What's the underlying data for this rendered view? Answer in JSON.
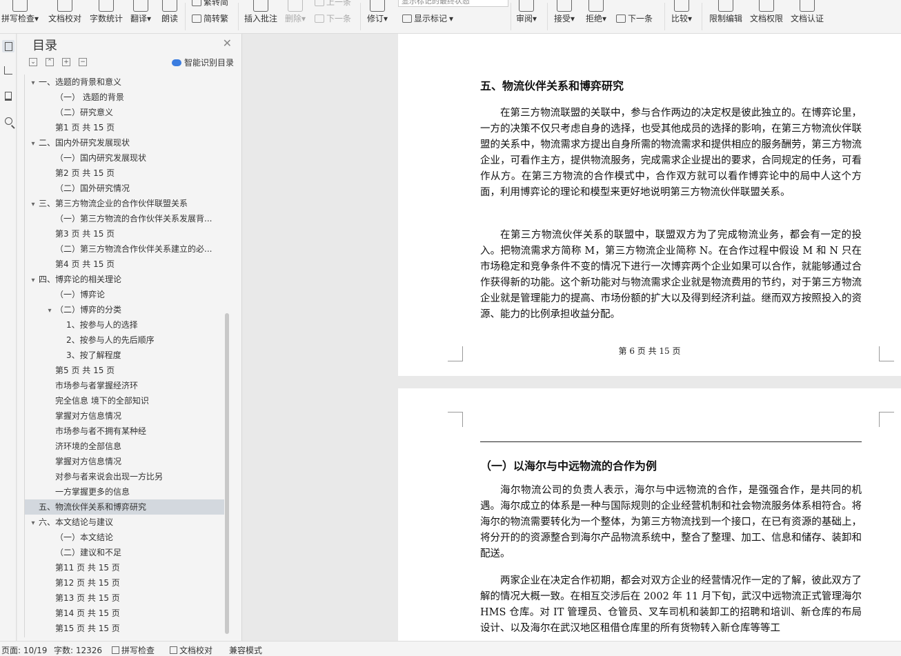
{
  "ribbon": {
    "buttons": [
      {
        "label": "拼写检查",
        "dropdown": true
      },
      {
        "label": "文档校对",
        "dropdown": false
      },
      {
        "label": "字数统计",
        "dropdown": false
      },
      {
        "label": "翻译",
        "dropdown": true
      },
      {
        "label": "朗读",
        "dropdown": false
      },
      {
        "label": "插入批注",
        "dropdown": false
      },
      {
        "label": "删除",
        "dropdown": true,
        "disabled": true
      },
      {
        "label": "修订",
        "dropdown": true
      },
      {
        "label": "审阅",
        "dropdown": true
      },
      {
        "label": "接受",
        "dropdown": true
      },
      {
        "label": "拒绝",
        "dropdown": true
      },
      {
        "label": "比较",
        "dropdown": true
      },
      {
        "label": "限制编辑",
        "dropdown": false
      },
      {
        "label": "文档权限",
        "dropdown": false
      },
      {
        "label": "文档认证",
        "dropdown": false
      }
    ],
    "simp_trad_top": "繁转简",
    "trad_simp": "简转繁",
    "prev": "上一条",
    "next": "下一条",
    "show_markup": "显示标记",
    "markup_mode": "显示标记的最终状态",
    "next_change": "下一条"
  },
  "toc": {
    "title": "目录",
    "smart_label": "智能识别目录",
    "items": [
      {
        "text": "一、选题的背景和意义",
        "level": 0,
        "toggle": "▾"
      },
      {
        "text": "（一）  选题的背景",
        "level": 1,
        "toggle": ""
      },
      {
        "text": "（二）研究意义",
        "level": 1,
        "toggle": ""
      },
      {
        "text": "第1 页 共 15 页",
        "level": 1,
        "toggle": ""
      },
      {
        "text": "二、国内外研究发展现状",
        "level": 0,
        "toggle": "▾"
      },
      {
        "text": "（一）国内研究发展现状",
        "level": 1,
        "toggle": ""
      },
      {
        "text": "第2 页 共 15 页",
        "level": 1,
        "toggle": ""
      },
      {
        "text": "（二）国外研究情况",
        "level": 1,
        "toggle": ""
      },
      {
        "text": "三、第三方物流企业的合作伙伴联盟关系",
        "level": 0,
        "toggle": "▾"
      },
      {
        "text": "（一）第三方物流的合作伙伴关系发展背...",
        "level": 1,
        "toggle": ""
      },
      {
        "text": "第3 页 共 15 页",
        "level": 1,
        "toggle": ""
      },
      {
        "text": "（二）第三方物流合作伙伴关系建立的必...",
        "level": 1,
        "toggle": ""
      },
      {
        "text": "第4 页 共 15 页",
        "level": 1,
        "toggle": ""
      },
      {
        "text": "四、博弈论的相关理论",
        "level": 0,
        "toggle": "▾"
      },
      {
        "text": "（一）博弈论",
        "level": 1,
        "toggle": ""
      },
      {
        "text": "（二）博弈的分类",
        "level": 1,
        "toggle": "▾"
      },
      {
        "text": "1、按参与人的选择",
        "level": 2,
        "toggle": ""
      },
      {
        "text": "2、按参与人的先后顺序",
        "level": 2,
        "toggle": ""
      },
      {
        "text": "3、按了解程度",
        "level": 2,
        "toggle": ""
      },
      {
        "text": "第5 页 共 15 页",
        "level": 1,
        "toggle": ""
      },
      {
        "text": "市场参与者掌握经济环",
        "level": 1,
        "toggle": ""
      },
      {
        "text": "完全信息 境下的全部知识",
        "level": 1,
        "toggle": ""
      },
      {
        "text": "掌握对方信息情况",
        "level": 1,
        "toggle": ""
      },
      {
        "text": "市场参与者不拥有某种经",
        "level": 1,
        "toggle": ""
      },
      {
        "text": "济环境的全部信息",
        "level": 1,
        "toggle": ""
      },
      {
        "text": "掌握对方信息情况",
        "level": 1,
        "toggle": ""
      },
      {
        "text": "对参与者来说会出现一方比另",
        "level": 1,
        "toggle": ""
      },
      {
        "text": "一方掌握更多的信息",
        "level": 1,
        "toggle": ""
      },
      {
        "text": "五、物流伙伴关系和博弈研究",
        "level": 0,
        "toggle": "",
        "selected": true
      },
      {
        "text": "六、本文结论与建议",
        "level": 0,
        "toggle": "▾"
      },
      {
        "text": "（一）本文结论",
        "level": 1,
        "toggle": ""
      },
      {
        "text": "（二）建议和不足",
        "level": 1,
        "toggle": ""
      },
      {
        "text": "第11 页 共 15 页",
        "level": 1,
        "toggle": ""
      },
      {
        "text": "第12 页 共 15 页",
        "level": 1,
        "toggle": ""
      },
      {
        "text": "第13 页 共 15 页",
        "level": 1,
        "toggle": ""
      },
      {
        "text": "第14 页 共 15 页",
        "level": 1,
        "toggle": ""
      },
      {
        "text": "第15 页 共 15 页",
        "level": 1,
        "toggle": ""
      }
    ]
  },
  "document": {
    "page1": {
      "heading": "五、物流伙伴关系和博弈研究",
      "para1": "在第三方物流联盟的关联中，参与合作两边的决定权是彼此独立的。在博弈论里，一方的决策不仅只考虑自身的选择，也受其他成员的选择的影响，在第三方物流伙伴联盟的关系中，物流需求方提出自身所需的物流需求和提供相应的服务酬劳，第三方物流企业，可看作主方，提供物流服务，完成需求企业提出的要求，合同规定的任务，可看作从方。在第三方物流的合作模式中，合作双方就可以看作博弈论中的局中人这个方面，利用博弈论的理论和模型来更好地说明第三方物流伙伴联盟关系。",
      "para2": "在第三方物流伙伴关系的联盟中，联盟双方为了完成物流业务，都会有一定的投入。把物流需求方简称 M，第三方物流企业简称 N。在合作过程中假设 M 和 N 只在市场稳定和竞争条件不变的情况下进行一次博弈两个企业如果可以合作，就能够通过合作获得新的功能。这个新功能对与物流需求企业就是物流费用的节约，对于第三方物流企业就是管理能力的提高、市场份额的扩大以及得到经济利益。继而双方按照投入的资源、能力的比例承担收益分配。",
      "footer": "第 6 页 共 15 页"
    },
    "page2": {
      "heading": "（一）以海尔与中远物流的合作为例",
      "para1": "海尔物流公司的负责人表示，海尔与中远物流的合作，是强强合作，是共同的机遇。海尔成立的体系是一种与国际规则的企业经营机制和社会物流服务体系相符合。将海尔的物流需要转化为一个整体，为第三方物流找到一个接口，在已有资源的基础上，将分开的的资源整合到海尔产品物流系统中，整合了整理、加工、信息和储存、装卸和配送。",
      "para2": "两家企业在决定合作初期，都会对双方企业的经营情况作一定的了解，彼此双方了解的情况大概一致。在相互交涉后在 2002 年 11 月下旬，武汉中远物流正式管理海尔 HMS 仓库。对 IT 管理员、仓管员、叉车司机和装卸工的招聘和培训、新仓库的布局设计、以及海尔在武汉地区租借仓库里的所有货物转入新仓库等等工"
    }
  },
  "status": {
    "page": "页面: 10/19",
    "words": "字数: 12326",
    "spell": "拼写检查",
    "proof": "文档校对",
    "compat": "兼容模式"
  }
}
